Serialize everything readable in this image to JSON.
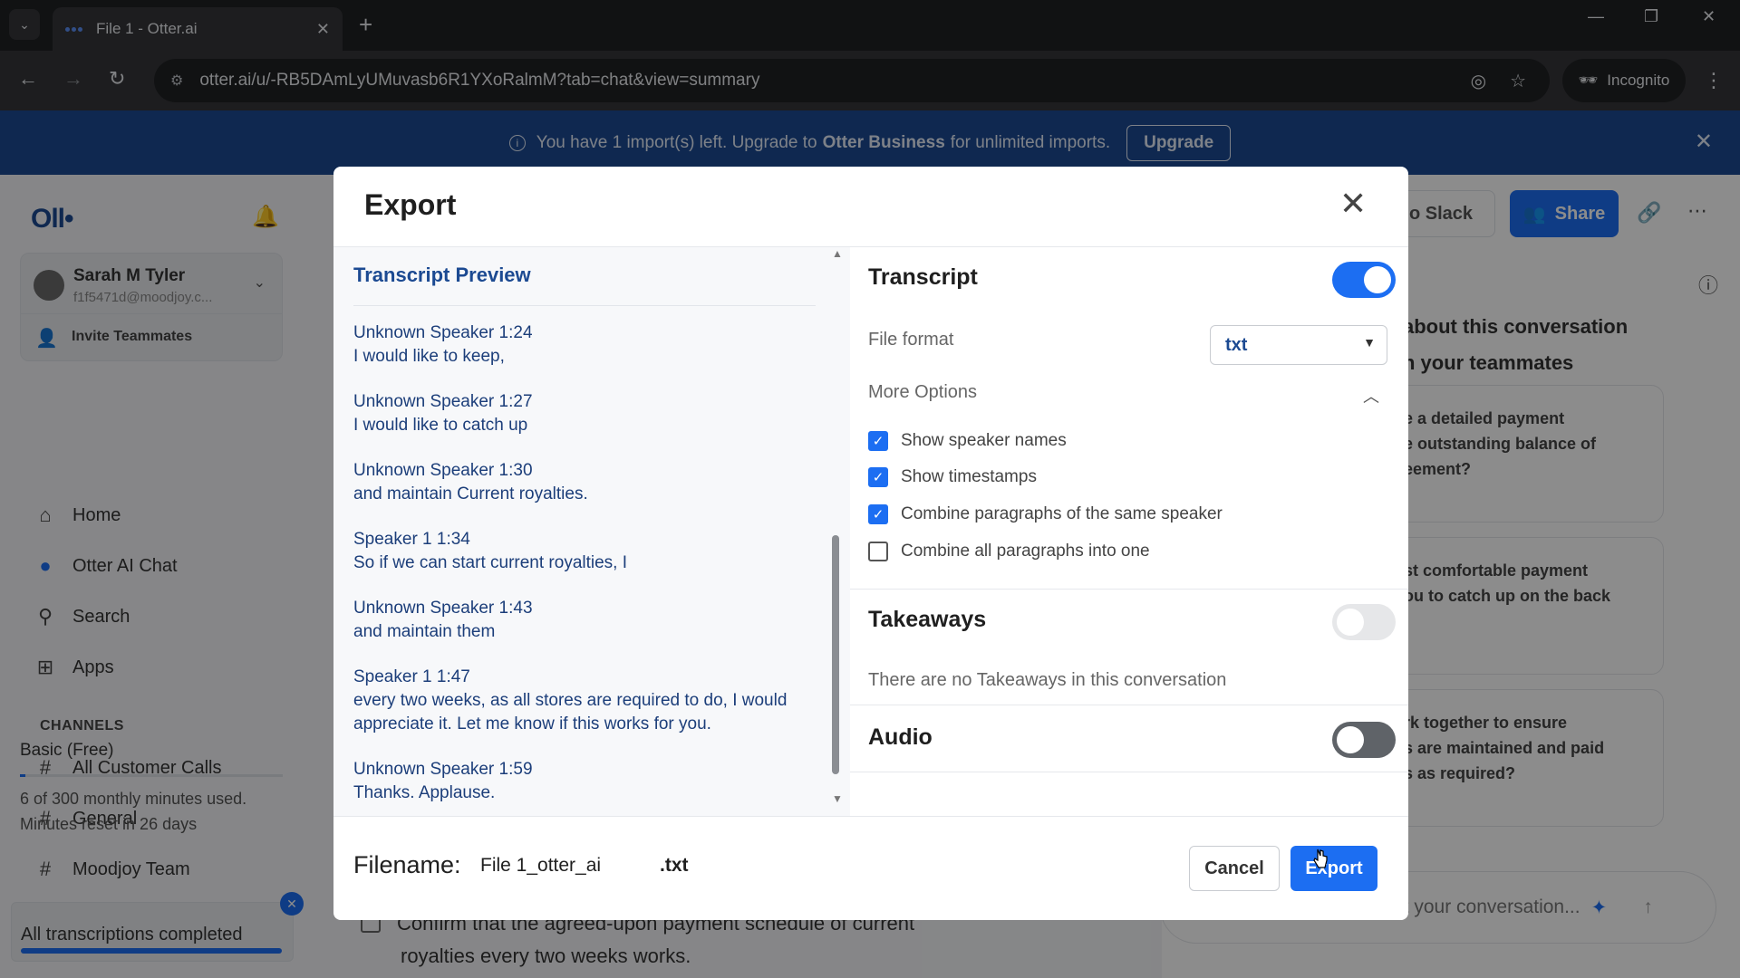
{
  "browser": {
    "tab_title": "File 1 - Otter.ai",
    "url": "otter.ai/u/-RB5DAmLyUMuvasb6R1YXoRalmM?tab=chat&view=summary",
    "incognito_label": "Incognito"
  },
  "banner": {
    "text_pre": "You have 1 import(s) left. Upgrade to ",
    "text_brand": "Otter Business",
    "text_post": " for unlimited imports.",
    "upgrade_label": "Upgrade"
  },
  "sidebar": {
    "logo": "Oll•",
    "user_name": "Sarah M Tyler",
    "user_email": "f1f5471d@moodjoy.c...",
    "invite_label": "Invite Teammates",
    "nav": [
      {
        "label": "Home"
      },
      {
        "label": "Otter AI Chat"
      },
      {
        "label": "Search"
      },
      {
        "label": "Apps"
      }
    ],
    "channels_header": "CHANNELS",
    "channels": [
      {
        "label": "All Customer Calls"
      },
      {
        "label": "General"
      },
      {
        "label": "Moodjoy Team"
      }
    ],
    "plan_name": "Basic (Free)",
    "plan_used_fraction": 0.02,
    "usage_line1": "6 of 300 monthly minutes used.",
    "usage_line2": "Minutes reset in 26 days",
    "toast_text": "All transcriptions completed"
  },
  "right_panel": {
    "slack_label": "o Slack",
    "share_label": "Share",
    "about_line1": "about this conversation",
    "about_line2": "n your teammates",
    "suggestions": [
      {
        "lines": [
          "e a detailed payment",
          "e outstanding balance of",
          "eement?"
        ]
      },
      {
        "lines": [
          "st comfortable payment",
          "ou to catch up on the back"
        ]
      },
      {
        "lines": [
          "rk together to ensure",
          "s are maintained and paid",
          "s as required?"
        ]
      }
    ],
    "ask_placeholder": "ut your conversation..."
  },
  "background": {
    "action_line1": "Confirm that the agreed-upon payment schedule of current",
    "action_line2": "royalties every two weeks works."
  },
  "modal": {
    "title": "Export",
    "preview_title": "Transcript Preview",
    "entries": [
      {
        "speaker": "Unknown Speaker  1:24",
        "text": "I would like to keep,"
      },
      {
        "speaker": "Unknown Speaker  1:27",
        "text": "I would like to catch up"
      },
      {
        "speaker": "Unknown Speaker  1:30",
        "text": "and maintain Current royalties."
      },
      {
        "speaker": "Speaker 1  1:34",
        "text": "So if we can start current royalties, I"
      },
      {
        "speaker": "Unknown Speaker  1:43",
        "text": "and maintain them"
      },
      {
        "speaker": "Speaker 1  1:47",
        "text": "every two weeks, as all stores are required to do, I would appreciate it. Let me know if this works for you."
      },
      {
        "speaker": "Unknown Speaker  1:59",
        "text": "Thanks. Applause."
      }
    ],
    "transcript": {
      "title": "Transcript",
      "enabled": true,
      "file_format_label": "File format",
      "file_format_value": "txt",
      "more_options_label": "More Options",
      "options": [
        {
          "label": "Show speaker names",
          "checked": true
        },
        {
          "label": "Show timestamps",
          "checked": true
        },
        {
          "label": "Combine paragraphs of the same speaker",
          "checked": true
        },
        {
          "label": "Combine all paragraphs into one",
          "checked": false
        }
      ]
    },
    "takeaways": {
      "title": "Takeaways",
      "enabled": false,
      "note": "There are no Takeaways in this conversation"
    },
    "audio": {
      "title": "Audio",
      "enabled": false
    },
    "filename_label": "Filename:",
    "filename_value": "File 1_otter_ai",
    "filename_ext": ".txt",
    "cancel_label": "Cancel",
    "export_label": "Export"
  }
}
